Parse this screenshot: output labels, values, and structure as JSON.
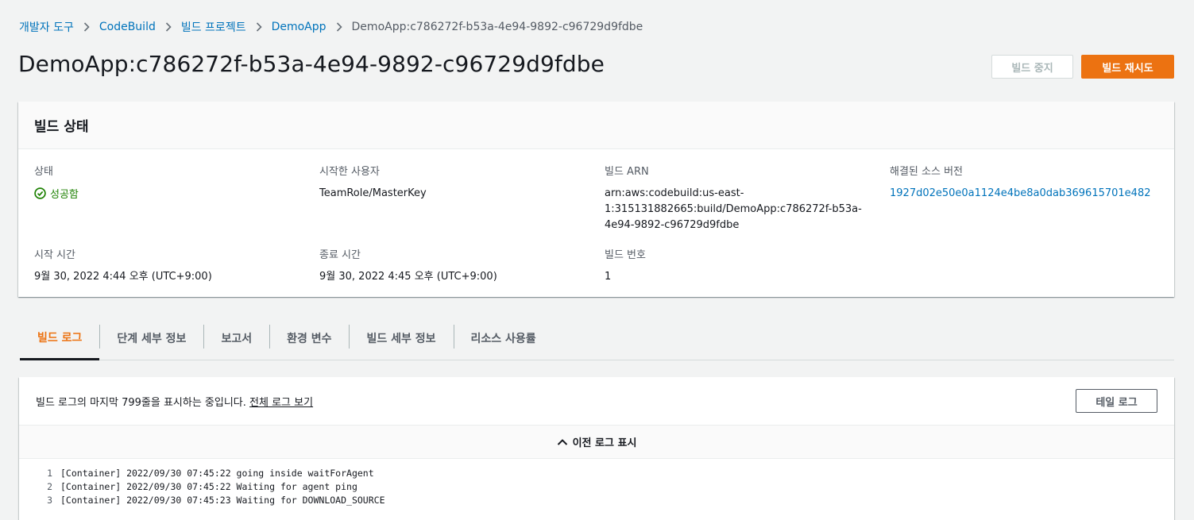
{
  "breadcrumb": {
    "items": [
      "개발자 도구",
      "CodeBuild",
      "빌드 프로젝트",
      "DemoApp"
    ],
    "current": "DemoApp:c786272f-b53a-4e94-9892-c96729d9fdbe"
  },
  "page": {
    "title": "DemoApp:c786272f-b53a-4e94-9892-c96729d9fdbe",
    "stop_label": "빌드 중지",
    "retry_label": "빌드 재시도"
  },
  "build_status": {
    "heading": "빌드 상태",
    "status_label": "상태",
    "status_value": "성공함",
    "initiator_label": "시작한 사용자",
    "initiator_value": "TeamRole/MasterKey",
    "arn_label": "빌드 ARN",
    "arn_lines": [
      "arn:aws:codebuild:us-east-",
      "1:315131882665:build/DemoApp:c786272f-b53a-",
      "4e94-9892-c96729d9fdbe"
    ],
    "source_label": "해결된 소스 버전",
    "source_value": "1927d02e50e0a1124e4be8a0dab369615701e482",
    "start_label": "시작 시간",
    "start_value": "9월 30, 2022 4:44 오후 (UTC+9:00)",
    "end_label": "종료 시간",
    "end_value": "9월 30, 2022 4:45 오후 (UTC+9:00)",
    "number_label": "빌드 번호",
    "number_value": "1"
  },
  "tabs": [
    "빌드 로그",
    "단계 세부 정보",
    "보고서",
    "환경 변수",
    "빌드 세부 정보",
    "리소스 사용률"
  ],
  "logs": {
    "info_text": "빌드 로그의 마지막 799줄을 표시하는 중입니다.",
    "full_link": "전체 로그 보기",
    "tail_label": "테일 로그",
    "prev_label": "이전 로그 표시",
    "lines": [
      {
        "n": "1",
        "text": "[Container] 2022/09/30 07:45:22 going inside waitForAgent"
      },
      {
        "n": "2",
        "text": "[Container] 2022/09/30 07:45:22 Waiting for agent ping"
      },
      {
        "n": "3",
        "text": "[Container] 2022/09/30 07:45:23 Waiting for DOWNLOAD_SOURCE"
      }
    ]
  },
  "colors": {
    "accent": "#ec7211",
    "link": "#0073bb",
    "success": "#1d8102"
  }
}
